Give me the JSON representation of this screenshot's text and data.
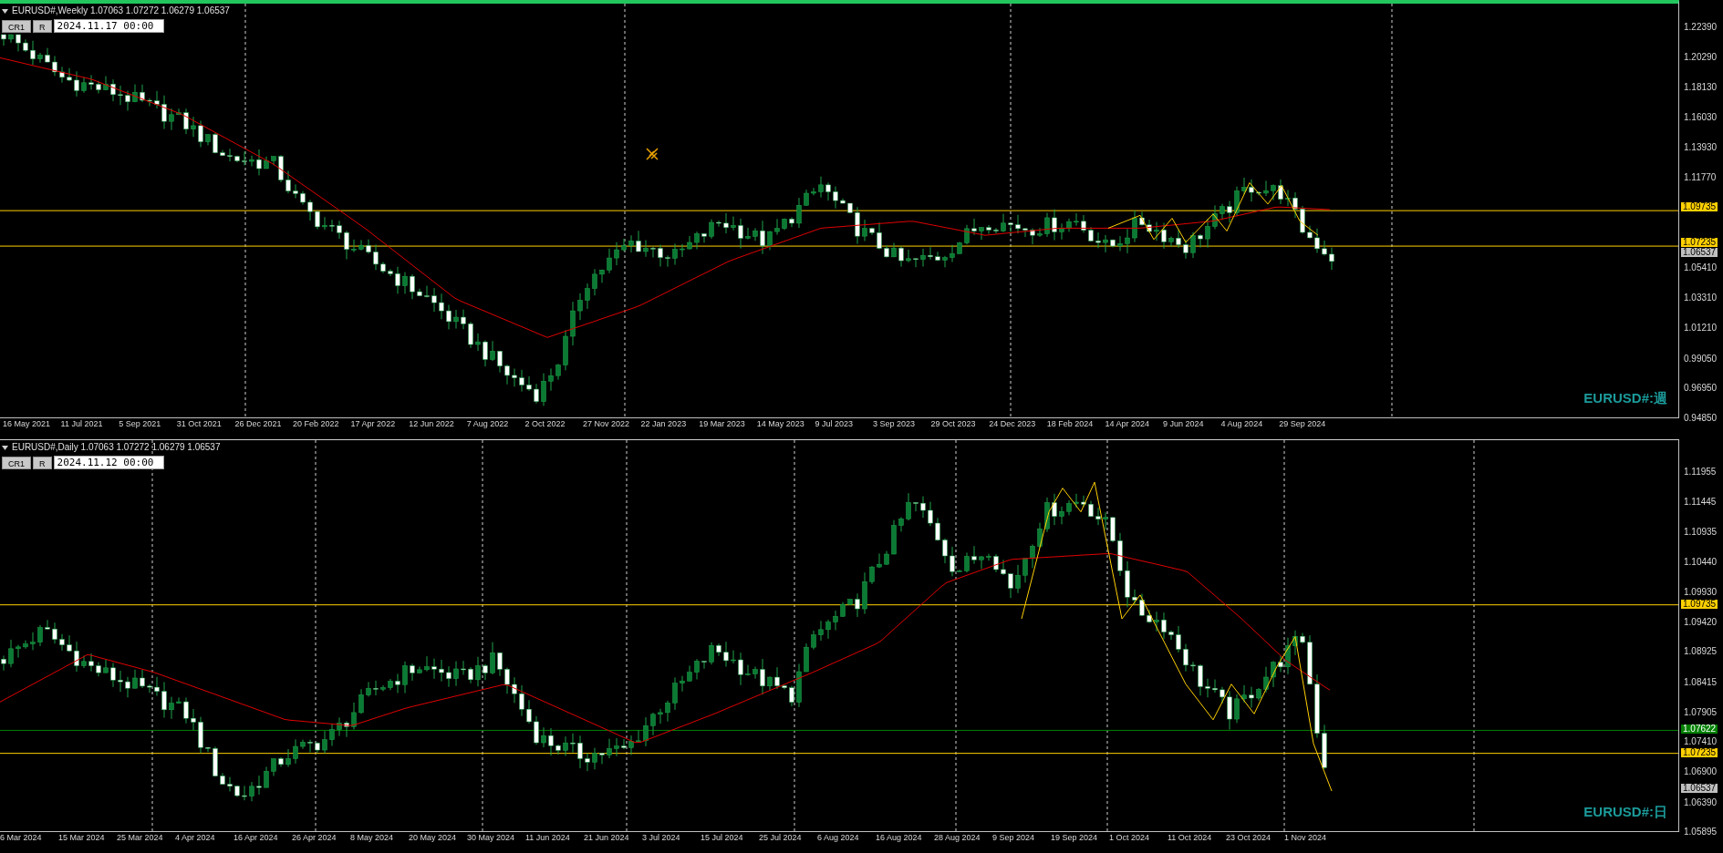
{
  "panels": [
    {
      "header": "EURUSD#,Weekly 1.07063 1.07272 1.06279 1.06537",
      "buttons": [
        "CR1",
        "R"
      ],
      "date": "2024.11.17 00:00",
      "watermark": "EURUSD#:週",
      "price_ticks": [
        "1.22390",
        "1.20290",
        "1.18130",
        "1.16030",
        "1.13930",
        "1.11770",
        "1.05410",
        "1.03310",
        "1.01210",
        "0.99050",
        "0.96950",
        "0.94850"
      ],
      "levels": [
        {
          "label": "1.09735",
          "kind": "line",
          "color": "#ffd000"
        },
        {
          "label": "1.07235",
          "kind": "line",
          "color": "#ffd000"
        },
        {
          "label": "1.06537",
          "kind": "bid",
          "color": "#c0c0c0"
        }
      ],
      "time_labels": [
        "16 May 2021",
        "11 Jul 2021",
        "5 Sep 2021",
        "31 Oct 2021",
        "26 Dec 2021",
        "20 Feb 2022",
        "17 Apr 2022",
        "12 Jun 2022",
        "7 Aug 2022",
        "2 Oct 2022",
        "27 Nov 2022",
        "22 Jan 2023",
        "19 Mar 2023",
        "14 May 2023",
        "9 Jul 2023",
        "3 Sep 2023",
        "29 Oct 2023",
        "24 Dec 2023",
        "18 Feb 2024",
        "14 Apr 2024",
        "9 Jun 2024",
        "4 Aug 2024",
        "29 Sep 2024"
      ]
    },
    {
      "header": "EURUSD#,Daily 1.07063 1.07272 1.06279 1.06537",
      "buttons": [
        "CR1",
        "R"
      ],
      "date": "2024.11.12 00:00",
      "watermark": "EURUSD#:日",
      "price_ticks": [
        "1.11955",
        "1.11445",
        "1.10935",
        "1.10440",
        "1.09930",
        "1.09420",
        "1.08925",
        "1.08415",
        "1.07905",
        "1.07410",
        "1.06900",
        "1.06390",
        "1.05895"
      ],
      "levels": [
        {
          "label": "1.09735",
          "kind": "line",
          "color": "#ffd000"
        },
        {
          "label": "1.07622",
          "kind": "line",
          "color": "#008000"
        },
        {
          "label": "1.07235",
          "kind": "line",
          "color": "#ffd000"
        },
        {
          "label": "1.06537",
          "kind": "bid",
          "color": "#c0c0c0"
        }
      ],
      "time_labels": [
        "6 Mar 2024",
        "15 Mar 2024",
        "25 Mar 2024",
        "4 Apr 2024",
        "16 Apr 2024",
        "26 Apr 2024",
        "8 May 2024",
        "20 May 2024",
        "30 May 2024",
        "11 Jun 2024",
        "21 Jun 2024",
        "3 Jul 2024",
        "15 Jul 2024",
        "25 Jul 2024",
        "6 Aug 2024",
        "16 Aug 2024",
        "28 Aug 2024",
        "9 Sep 2024",
        "19 Sep 2024",
        "1 Oct 2024",
        "11 Oct 2024",
        "23 Oct 2024",
        "1 Nov 2024"
      ]
    }
  ]
}
